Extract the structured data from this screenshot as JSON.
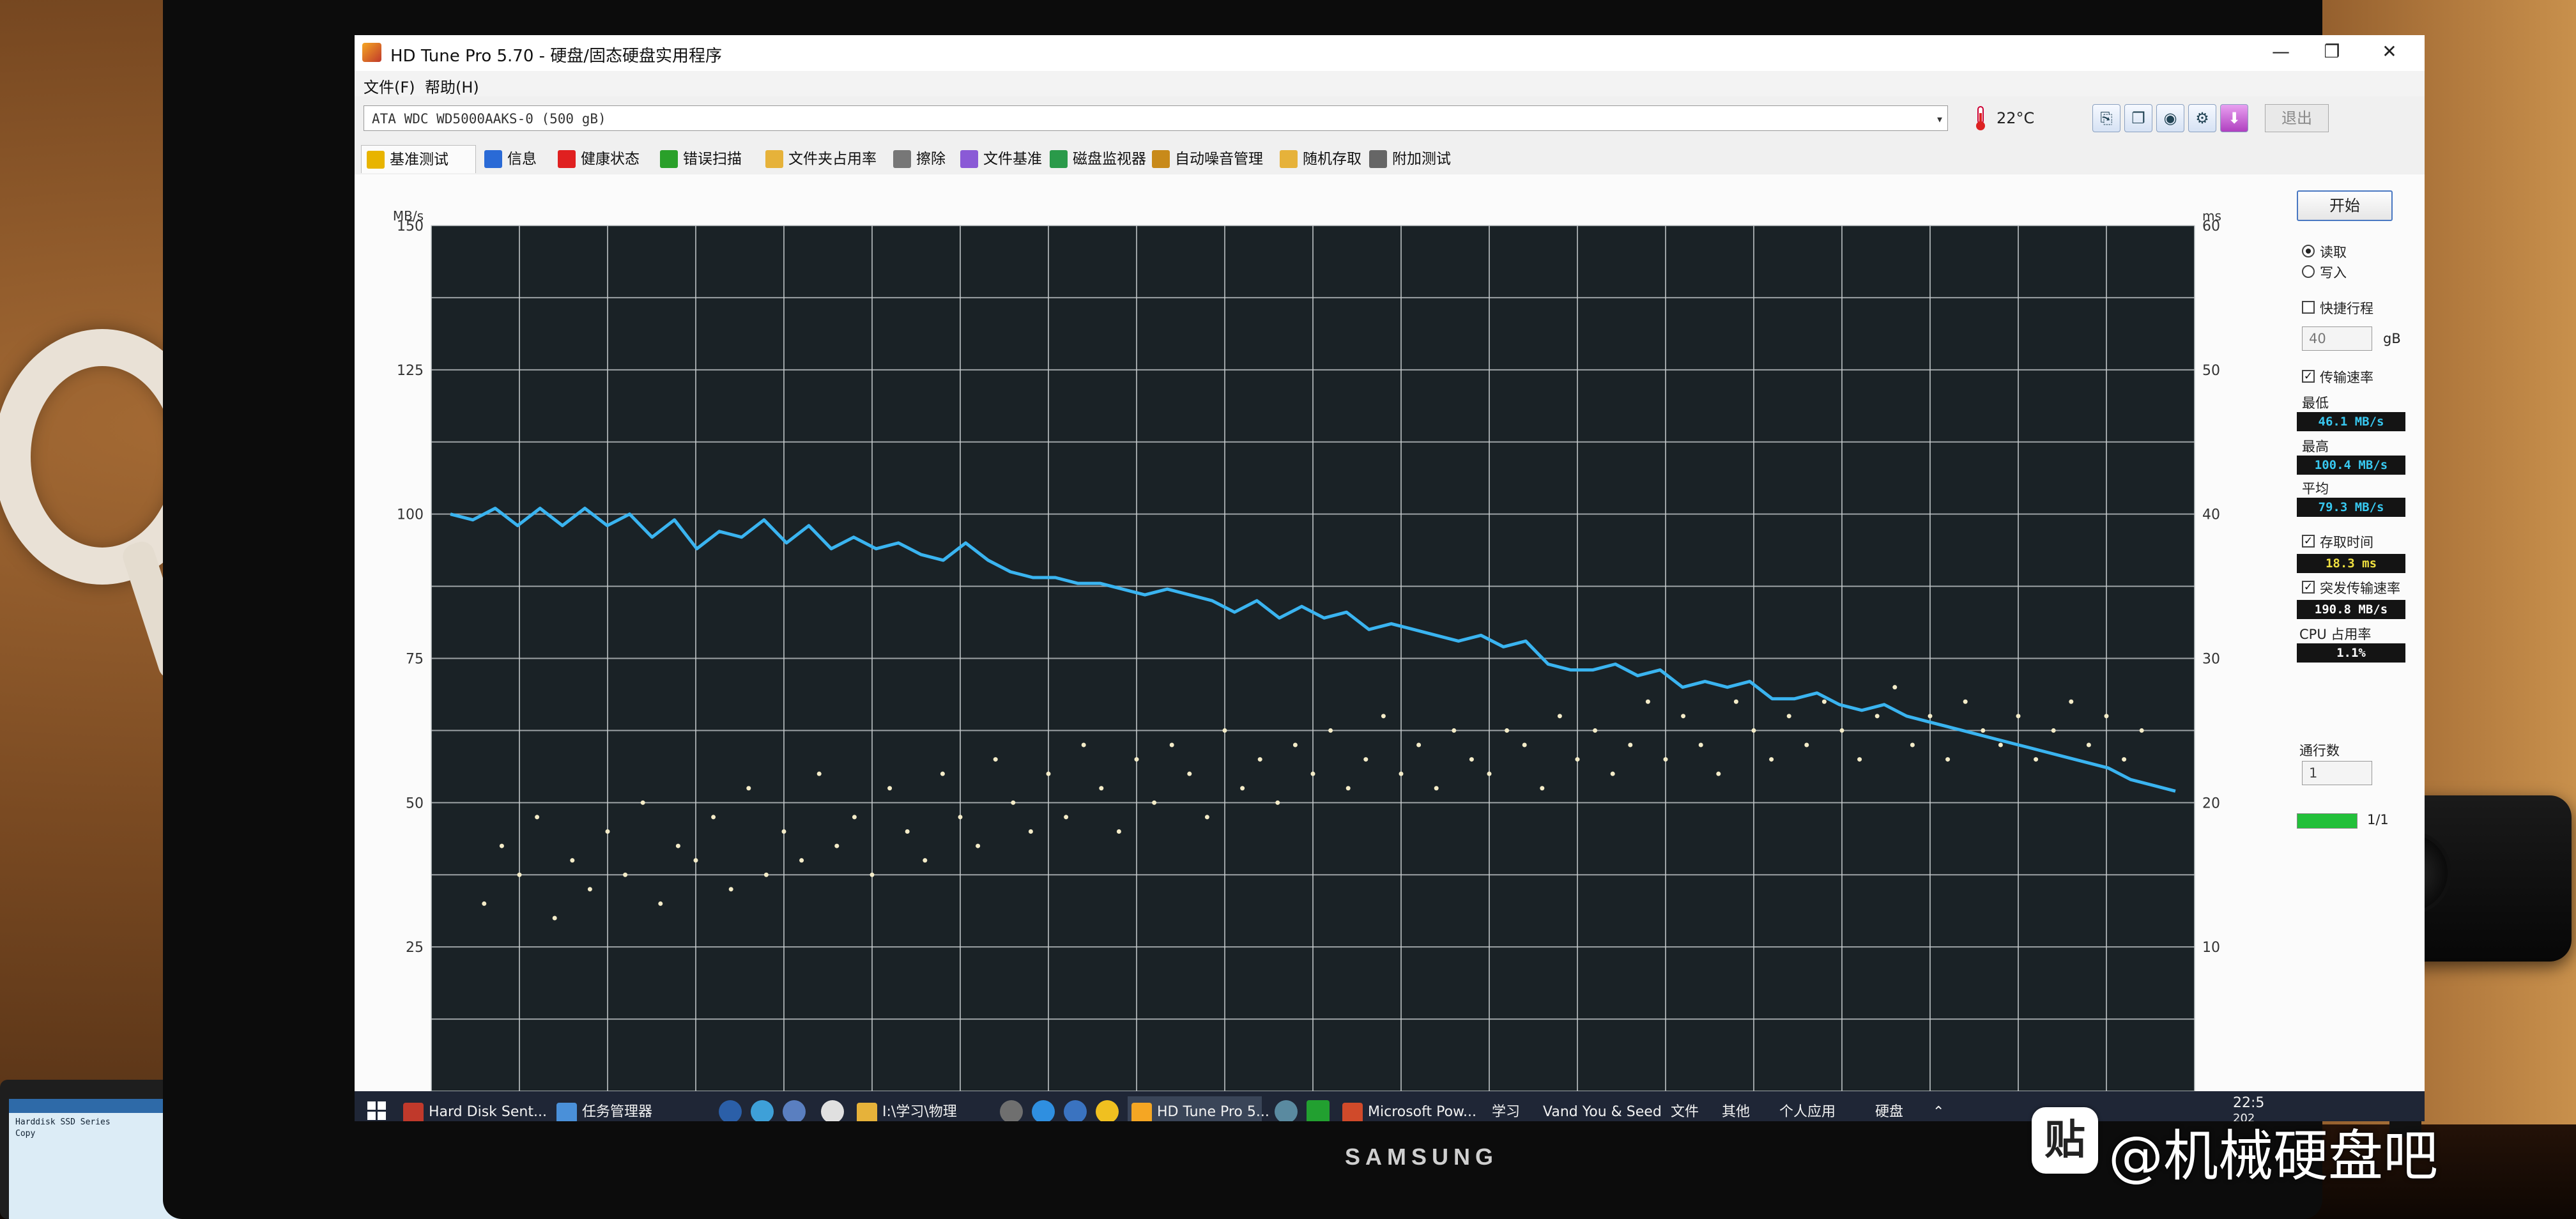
{
  "window": {
    "title": "HD Tune Pro 5.70 - 硬盘/固态硬盘实用程序",
    "minimize": "—",
    "maximize": "❐",
    "close": "✕"
  },
  "menu": {
    "items": [
      "文件(F)",
      "帮助(H)"
    ]
  },
  "toolbar": {
    "drive": "ATA    WDC WD5000AAKS-0 (500 gB)",
    "temperature": "22°C",
    "exit_label": "退出",
    "buttons": [
      "copy-info-icon",
      "copy-screen-icon",
      "screenshot-icon",
      "options-icon",
      "save-icon"
    ]
  },
  "tabs": [
    {
      "label": "基准测试",
      "icon": "benchmark-icon",
      "color": "#e8b400",
      "active": true
    },
    {
      "label": "信息",
      "icon": "info-icon",
      "color": "#2a6ad6"
    },
    {
      "label": "健康状态",
      "icon": "health-cross-icon",
      "color": "#e02020"
    },
    {
      "label": "错误扫描",
      "icon": "error-scan-icon",
      "color": "#2aa02a"
    },
    {
      "label": "文件夹占用率",
      "icon": "folder-icon",
      "color": "#e6b23a"
    },
    {
      "label": "擦除",
      "icon": "erase-icon",
      "color": "#777777"
    },
    {
      "label": "文件基准",
      "icon": "file-benchmark-icon",
      "color": "#8a5ad6"
    },
    {
      "label": "磁盘监视器",
      "icon": "disk-monitor-icon",
      "color": "#2a9a4a"
    },
    {
      "label": "自动噪音管理",
      "icon": "sound-icon",
      "color": "#c88a1a"
    },
    {
      "label": "随机存取",
      "icon": "random-access-icon",
      "color": "#e6b23a"
    },
    {
      "label": "附加测试",
      "icon": "extra-tests-icon",
      "color": "#666666"
    }
  ],
  "chart": {
    "y_left_unit": "MB/s",
    "y_right_unit": "ms",
    "y_left_ticks": [
      "150",
      "125",
      "100",
      "75",
      "50",
      "25"
    ],
    "y_right_ticks": [
      "60",
      "50",
      "40",
      "30",
      "20",
      "10"
    ]
  },
  "chart_data": {
    "type": "line",
    "ylabel": "MB/s",
    "y2label": "ms",
    "ylim": [
      0,
      150
    ],
    "y2lim": [
      0,
      60
    ],
    "grid": true,
    "series": [
      {
        "color": "#3ab4f0",
        "values": [
          100,
          99,
          101,
          98,
          101,
          98,
          101,
          98,
          100,
          96,
          99,
          94,
          97,
          96,
          99,
          95,
          98,
          94,
          96,
          94,
          95,
          93,
          92,
          95,
          92,
          90,
          89,
          89,
          88,
          88,
          87,
          86,
          87,
          86,
          85,
          83,
          85,
          82,
          84,
          82,
          83,
          80,
          81,
          80,
          79,
          78,
          79,
          77,
          78,
          74,
          73,
          73,
          74,
          72,
          73,
          70,
          71,
          70,
          71,
          68,
          68,
          69,
          67,
          66,
          67,
          65,
          64,
          63,
          62,
          61,
          60,
          59,
          58,
          57,
          56,
          54,
          53,
          52
        ]
      },
      {
        "type": "scatter",
        "color": "#f4ecc8",
        "description_only": false,
        "x_range": [
          0,
          1
        ],
        "y_range_ms": [
          10,
          28
        ],
        "points": [
          [
            0.03,
            13
          ],
          [
            0.04,
            17
          ],
          [
            0.05,
            15
          ],
          [
            0.06,
            19
          ],
          [
            0.07,
            12
          ],
          [
            0.08,
            16
          ],
          [
            0.09,
            14
          ],
          [
            0.1,
            18
          ],
          [
            0.11,
            15
          ],
          [
            0.12,
            20
          ],
          [
            0.13,
            13
          ],
          [
            0.14,
            17
          ],
          [
            0.15,
            16
          ],
          [
            0.16,
            19
          ],
          [
            0.17,
            14
          ],
          [
            0.18,
            21
          ],
          [
            0.19,
            15
          ],
          [
            0.2,
            18
          ],
          [
            0.21,
            16
          ],
          [
            0.22,
            22
          ],
          [
            0.23,
            17
          ],
          [
            0.24,
            19
          ],
          [
            0.25,
            15
          ],
          [
            0.26,
            21
          ],
          [
            0.27,
            18
          ],
          [
            0.28,
            16
          ],
          [
            0.29,
            22
          ],
          [
            0.3,
            19
          ],
          [
            0.31,
            17
          ],
          [
            0.32,
            23
          ],
          [
            0.33,
            20
          ],
          [
            0.34,
            18
          ],
          [
            0.35,
            22
          ],
          [
            0.36,
            19
          ],
          [
            0.37,
            24
          ],
          [
            0.38,
            21
          ],
          [
            0.39,
            18
          ],
          [
            0.4,
            23
          ],
          [
            0.41,
            20
          ],
          [
            0.42,
            24
          ],
          [
            0.43,
            22
          ],
          [
            0.44,
            19
          ],
          [
            0.45,
            25
          ],
          [
            0.46,
            21
          ],
          [
            0.47,
            23
          ],
          [
            0.48,
            20
          ],
          [
            0.49,
            24
          ],
          [
            0.5,
            22
          ],
          [
            0.51,
            25
          ],
          [
            0.52,
            21
          ],
          [
            0.53,
            23
          ],
          [
            0.54,
            26
          ],
          [
            0.55,
            22
          ],
          [
            0.56,
            24
          ],
          [
            0.57,
            21
          ],
          [
            0.58,
            25
          ],
          [
            0.59,
            23
          ],
          [
            0.6,
            22
          ],
          [
            0.61,
            25
          ],
          [
            0.62,
            24
          ],
          [
            0.63,
            21
          ],
          [
            0.64,
            26
          ],
          [
            0.65,
            23
          ],
          [
            0.66,
            25
          ],
          [
            0.67,
            22
          ],
          [
            0.68,
            24
          ],
          [
            0.69,
            27
          ],
          [
            0.7,
            23
          ],
          [
            0.71,
            26
          ],
          [
            0.72,
            24
          ],
          [
            0.73,
            22
          ],
          [
            0.74,
            27
          ],
          [
            0.75,
            25
          ],
          [
            0.76,
            23
          ],
          [
            0.77,
            26
          ],
          [
            0.78,
            24
          ],
          [
            0.79,
            27
          ],
          [
            0.8,
            25
          ],
          [
            0.81,
            23
          ],
          [
            0.82,
            26
          ],
          [
            0.83,
            28
          ],
          [
            0.84,
            24
          ],
          [
            0.85,
            26
          ],
          [
            0.86,
            23
          ],
          [
            0.87,
            27
          ],
          [
            0.88,
            25
          ],
          [
            0.89,
            24
          ],
          [
            0.9,
            26
          ],
          [
            0.91,
            23
          ],
          [
            0.92,
            25
          ],
          [
            0.93,
            27
          ],
          [
            0.94,
            24
          ],
          [
            0.95,
            26
          ],
          [
            0.96,
            23
          ],
          [
            0.97,
            25
          ]
        ]
      }
    ]
  },
  "panel": {
    "start_label": "开始",
    "read_label": "读取",
    "write_label": "写入",
    "short_stroke_label": "快捷行程",
    "short_stroke_value": "40",
    "short_stroke_unit": "gB",
    "transfer_rate_label": "传输速率",
    "min_label": "最低",
    "min_value": "46.1 MB/s",
    "max_label": "最高",
    "max_value": "100.4 MB/s",
    "avg_label": "平均",
    "avg_value": "79.3 MB/s",
    "access_time_label": "存取时间",
    "access_time_value": "18.3 ms",
    "burst_label": "突发传输速率",
    "burst_value": "190.8 MB/s",
    "cpu_label": "CPU 占用率",
    "cpu_value": "1.1%",
    "pass_label": "通行数",
    "pass_value": "1",
    "pass_progress": "1/1",
    "progress_fraction": 1.0,
    "colors": {
      "cyan": "#38c8f0",
      "yellow": "#f0e040",
      "white": "#ffffff"
    }
  },
  "taskbar": {
    "apps": [
      {
        "label": "Hard Disk Sent...",
        "icon": "hard-disk-sentinel-icon",
        "color": "#c0392b"
      },
      {
        "label": "任务管理器",
        "icon": "task-manager-icon",
        "color": "#4a90d9"
      },
      {
        "label": "I:\\学习\\物理",
        "icon": "folder-icon",
        "color": "#e6b23a"
      },
      {
        "label": "HD Tune Pro 5...",
        "icon": "hdtune-icon",
        "color": "#f5a623",
        "active": true
      },
      {
        "label": "Microsoft Pow...",
        "icon": "powerpoint-icon",
        "color": "#d04a2a"
      }
    ],
    "folders": [
      "学习",
      "Vand You & Seed",
      "文件",
      "其他",
      "个人应用",
      "硬盘"
    ],
    "clock": "22:5",
    "date": "202"
  },
  "monitor_brand": "SAMSUNG",
  "laptop": {
    "lines": [
      "Harddisk SSD Series",
      "Copy"
    ]
  },
  "watermark": {
    "logo_char": "贴",
    "text": "@机械硬盘吧"
  }
}
